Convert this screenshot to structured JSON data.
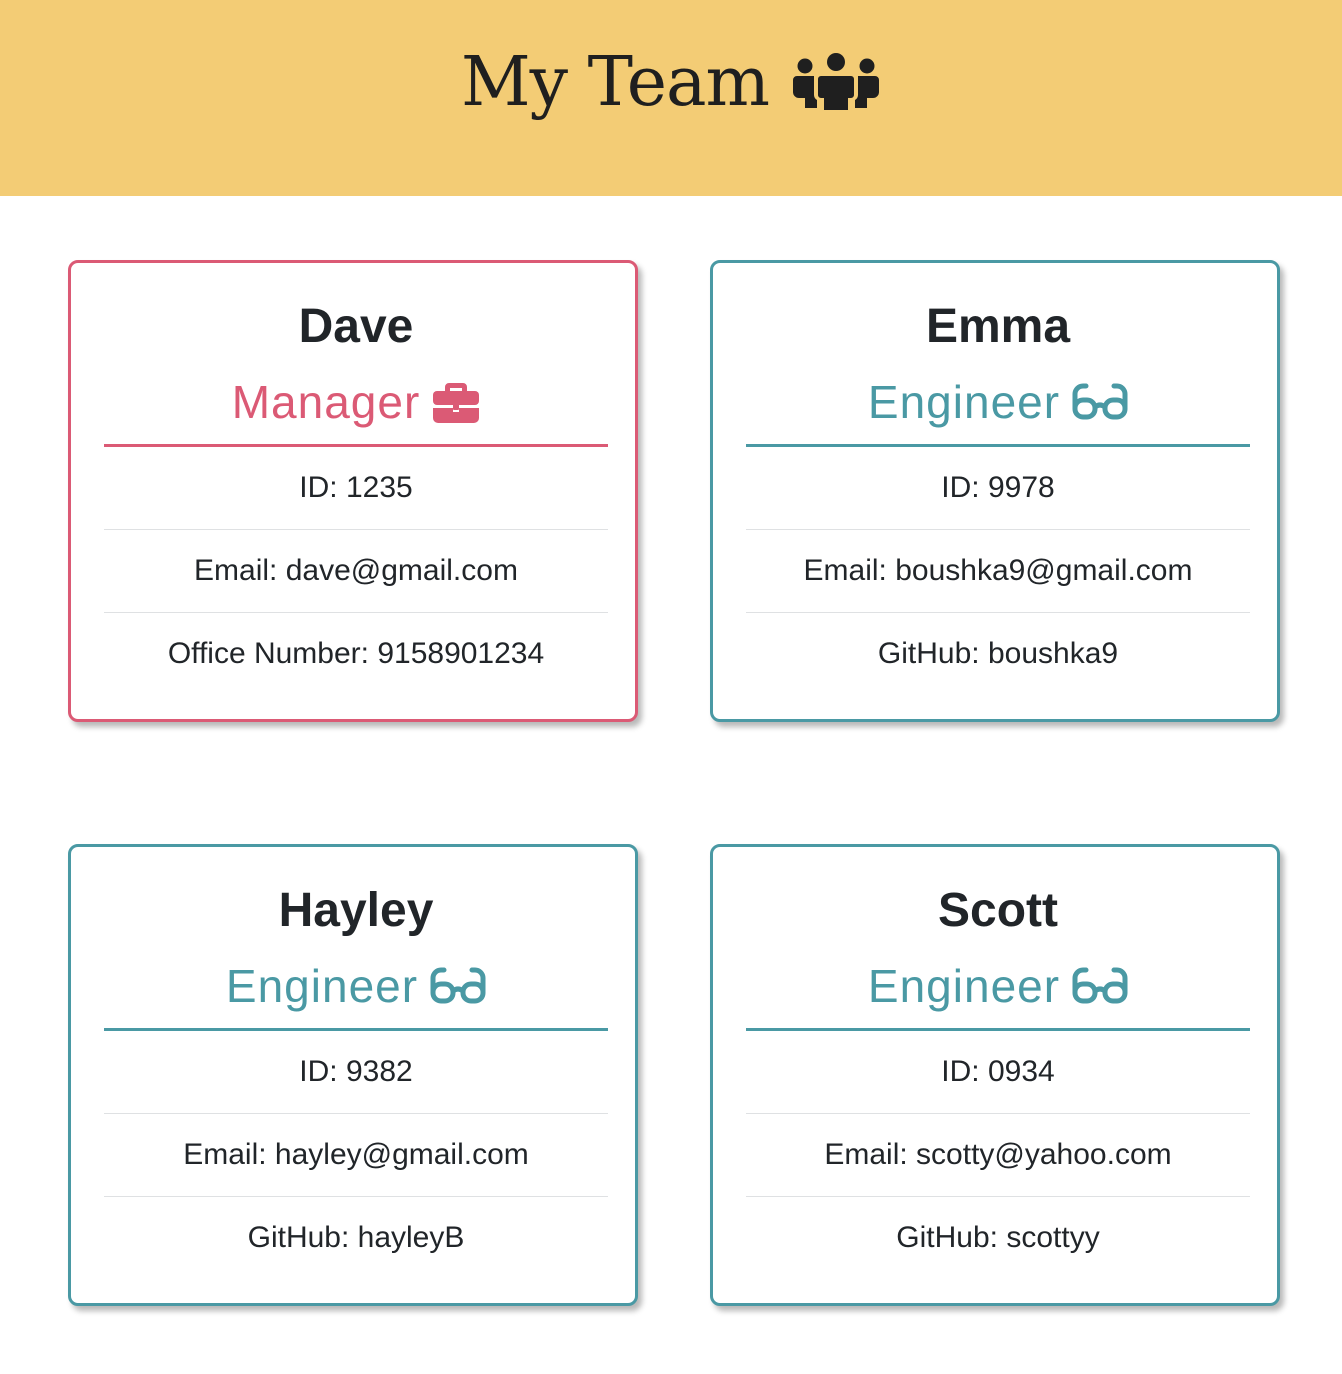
{
  "header": {
    "title": "My Team",
    "icon": "users-icon",
    "background": "#f3cc75"
  },
  "colors": {
    "manager": "#db5a75",
    "engineer": "#4a99a4"
  },
  "team": [
    {
      "name": "Dave",
      "role": "Manager",
      "role_icon": "briefcase-icon",
      "id": "ID: 1235",
      "email": "Email: dave@gmail.com",
      "extra": "Office Number: 9158901234"
    },
    {
      "name": "Emma",
      "role": "Engineer",
      "role_icon": "glasses-icon",
      "id": "ID: 9978",
      "email": "Email: boushka9@gmail.com",
      "extra": "GitHub: boushka9"
    },
    {
      "name": "Hayley",
      "role": "Engineer",
      "role_icon": "glasses-icon",
      "id": "ID: 9382",
      "email": "Email: hayley@gmail.com",
      "extra": "GitHub: hayleyB"
    },
    {
      "name": "Scott",
      "role": "Engineer",
      "role_icon": "glasses-icon",
      "id": "ID: 0934",
      "email": "Email: scotty@yahoo.com",
      "extra": "GitHub: scottyy"
    }
  ]
}
